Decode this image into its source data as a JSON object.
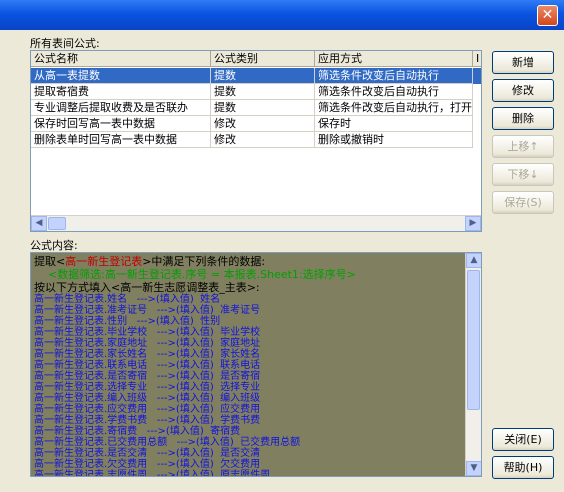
{
  "title_bar": {
    "close_glyph": "✕"
  },
  "labels": {
    "formula_list": "所有表间公式:",
    "formula_content": "公式内容:"
  },
  "grid": {
    "columns": [
      "公式名称",
      "公式类别",
      "应用方式",
      "I"
    ],
    "rows": [
      {
        "name": "从高一表提数",
        "type": "提数",
        "mode": "筛选条件改变后自动执行",
        "selected": true
      },
      {
        "name": "提取寄宿费",
        "type": "提数",
        "mode": "筛选条件改变后自动执行",
        "selected": false
      },
      {
        "name": "专业调整后提取收费及是否联办",
        "type": "提数",
        "mode": "筛选条件改变后自动执行，打开",
        "selected": false
      },
      {
        "name": "保存时回写高一表中数据",
        "type": "修改",
        "mode": "保存时",
        "selected": false
      },
      {
        "name": "删除表单时回写高一表中数据",
        "type": "修改",
        "mode": "删除或撤销时",
        "selected": false
      }
    ]
  },
  "content": {
    "header1_a": "提取<",
    "header1_b": "高一新生登记表",
    "header1_c": ">中满足下列条件的数据:",
    "header2": "    <数据筛选:高一新生登记表.序号 = 本报表.Sheet1:选择序号>",
    "header3": "按以下方式填入<高一新生志愿调整表_主表>:",
    "mappings": [
      "高一新生登记表.姓名   --->(填入值)  姓名",
      "高一新生登记表.准考证号   --->(填入值)  准考证号",
      "高一新生登记表.性别   --->(填入值)  性别",
      "高一新生登记表.毕业学校   --->(填入值)  毕业学校",
      "高一新生登记表.家庭地址   --->(填入值)  家庭地址",
      "高一新生登记表.家长姓名   --->(填入值)  家长姓名",
      "高一新生登记表.联系电话   --->(填入值)  联系电话",
      "高一新生登记表.是否寄宿   --->(填入值)  是否寄宿",
      "高一新生登记表.选择专业   --->(填入值)  选择专业",
      "高一新生登记表.编入班级   --->(填入值)  编入班级",
      "高一新生登记表.应交费用   --->(填入值)  应交费用",
      "高一新生登记表.学费书费   --->(填入值)  学费书费",
      "高一新生登记表.寄宿费   --->(填入值)  寄宿费",
      "高一新生登记表.已交费用总额   --->(填入值)  已交费用总额",
      "高一新生登记表.是否交清   --->(填入值)  是否交清",
      "高一新生登记表.欠交费用   --->(填入值)  欠交费用",
      "高一新生登记表.志愿件周   --->(填入值)  原志愿件周"
    ]
  },
  "buttons": {
    "add": "新增",
    "edit": "修改",
    "delete": "删除",
    "move_up": "上移↑",
    "move_down": "下移↓",
    "save": "保存(S)",
    "close": "关闭(E)",
    "help": "帮助(H)"
  },
  "colors": {
    "titlebar": "#0a54e0",
    "selection": "#316ac5",
    "content_bg": "#808060",
    "keyword_red": "#c00000",
    "filter_green": "#00a000",
    "mapping_blue": "#1010e0"
  }
}
